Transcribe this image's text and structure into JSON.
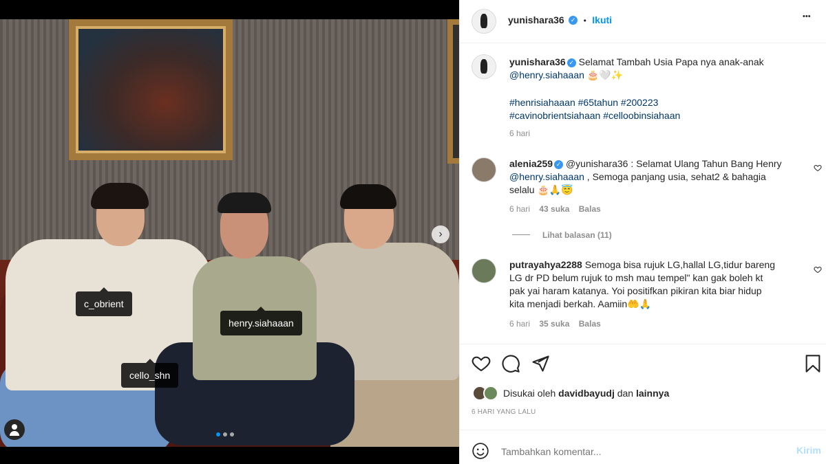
{
  "photo": {
    "tags": [
      "c_obrient",
      "cello_shn",
      "henry.siahaaan"
    ],
    "next_glyph": "›",
    "carousel_dots": 3,
    "active_dot": 0
  },
  "header": {
    "username": "yunishara36",
    "separator": "•",
    "follow_label": "Ikuti",
    "more_glyph": "•••"
  },
  "caption": {
    "username": "yunishara36",
    "text": "Selamat Tambah Usia Papa nya anak-anak",
    "mention": "@henry.siahaaan",
    "emojis": "🎂🤍✨",
    "hashtags_line1": "#henrisiahaaan #65tahun #200223",
    "hashtags_line2": "#cavinobrientsiahaan #celloobinsiahaan",
    "time": "6 hari"
  },
  "comments": [
    {
      "username": "alenia259",
      "verified": true,
      "line1": "@yunishara36 : Selamat Ulang Tahun Bang Henry",
      "line2": "@henry.siahaaan , Semoga panjang usia, sehat2 & bahagia",
      "line3": "selalu 🎂🙏😇",
      "time": "6 hari",
      "likes": "43 suka",
      "reply": "Balas",
      "view_replies": "Lihat balasan (11)"
    },
    {
      "username": "putrayahya2288",
      "verified": false,
      "line1": "Semoga bisa rujuk LG,hallal LG,tidur bareng",
      "line2": "LG dr PD belum rujuk to msh mau tempel\" kan gak boleh kt",
      "line3": "pak yai haram katanya. Yoi positifkan pikiran kita biar hidup",
      "line4": "kita menjadi berkah. Aamiin🤲🙏",
      "time": "6 hari",
      "likes": "35 suka",
      "reply": "Balas"
    }
  ],
  "likes": {
    "prefix": "Disukai oleh",
    "user": "davidbayudj",
    "joiner": "dan",
    "others": "lainnya"
  },
  "timestamp": "6 HARI YANG LALU",
  "comment_box": {
    "placeholder": "Tambahkan komentar...",
    "post_label": "Kirim"
  },
  "colors": {
    "accent": "#0095f6",
    "link": "#00376b",
    "muted": "#8e8e8e",
    "post_disabled": "#b2dffc"
  }
}
